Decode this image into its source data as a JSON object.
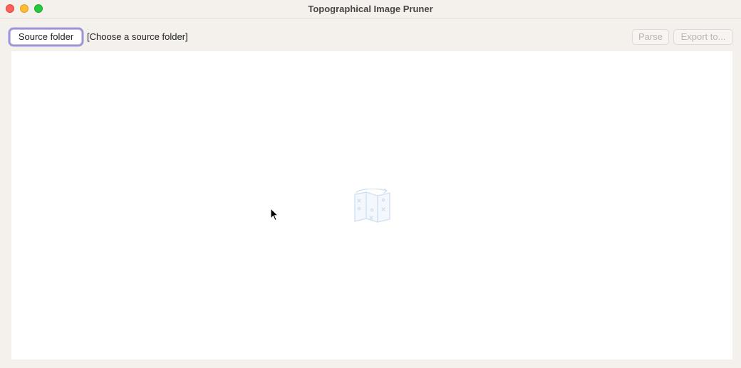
{
  "window": {
    "title": "Topographical Image Pruner"
  },
  "toolbar": {
    "source_button_label": "Source folder",
    "source_path_placeholder": "[Choose a source folder]",
    "parse_button_label": "Parse",
    "export_button_label": "Export to..."
  },
  "content": {
    "empty_state_icon": "map-icon"
  },
  "colors": {
    "focus_ring": "#9c93e4",
    "icon_tint": "#cfe0f2",
    "disabled_text": "#b9b5b2",
    "window_bg": "#f4f0ec"
  }
}
